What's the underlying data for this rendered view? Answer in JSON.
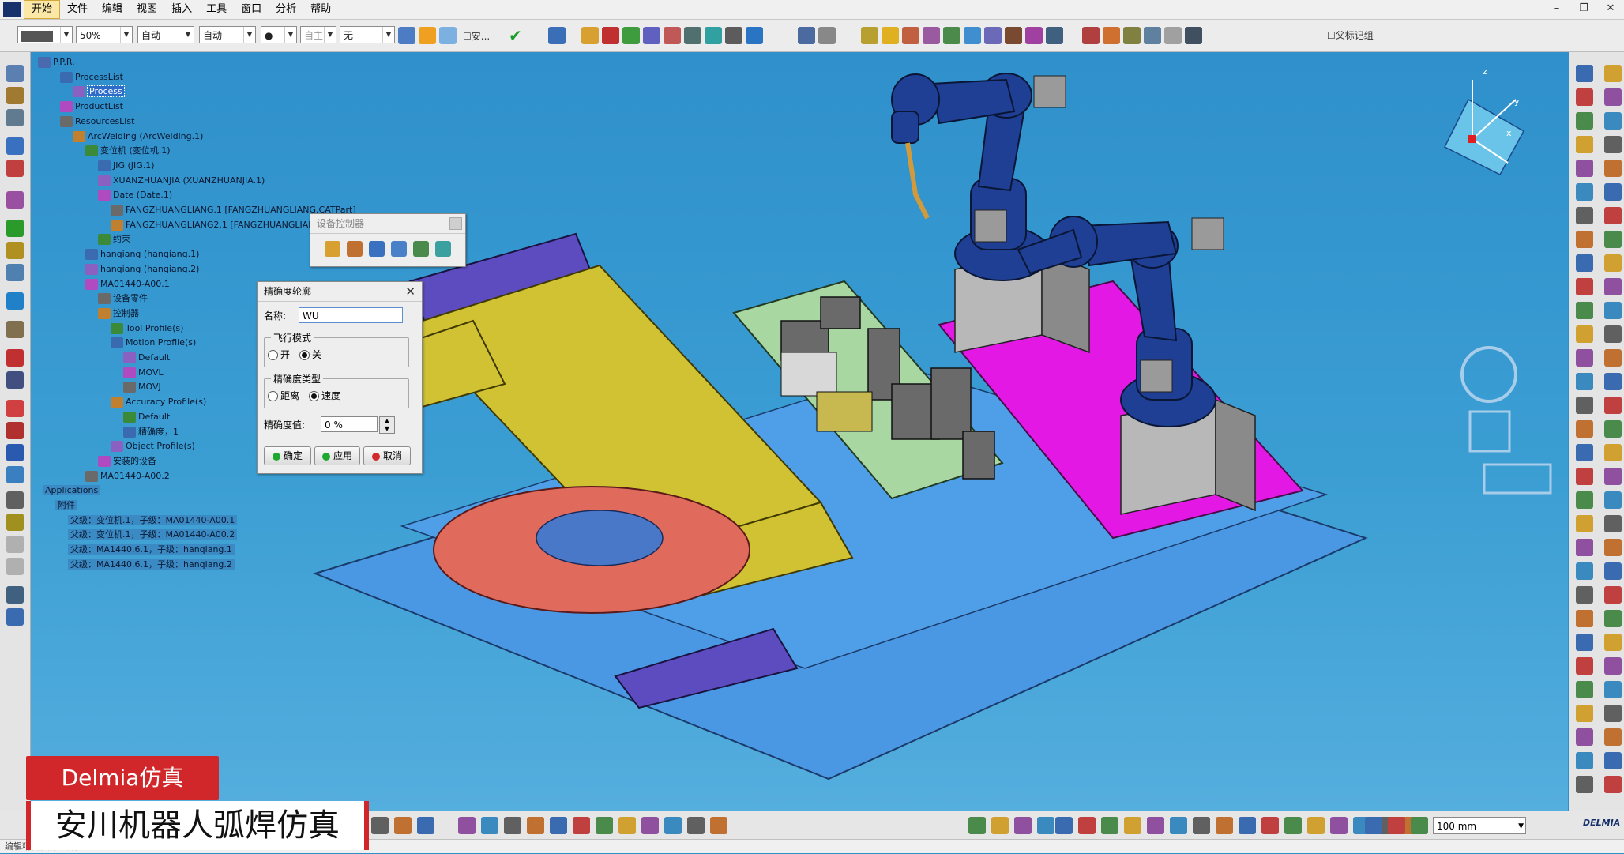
{
  "menu": [
    "开始",
    "文件",
    "编辑",
    "视图",
    "插入",
    "工具",
    "窗口",
    "分析",
    "帮助"
  ],
  "toolbar": {
    "color_value": "",
    "zoom_value": "50%",
    "line_type": "自动",
    "line_weight": "自动",
    "point_style": "●",
    "layer_label": "自主",
    "layer_value": "无",
    "safe_label": "安...",
    "parent_child_label": "父标记组"
  },
  "tree": {
    "root": "P.P.R.",
    "nodes": [
      {
        "label": "ProcessList",
        "indent": 1
      },
      {
        "label": "Process",
        "indent": 2,
        "selected": true
      },
      {
        "label": "ProductList",
        "indent": 1
      },
      {
        "label": "ResourcesList",
        "indent": 1
      },
      {
        "label": "ArcWelding (ArcWelding.1)",
        "indent": 2
      },
      {
        "label": "变位机 (变位机.1)",
        "indent": 3
      },
      {
        "label": "JIG (JIG.1)",
        "indent": 4
      },
      {
        "label": "XUANZHUANJIA (XUANZHUANJIA.1)",
        "indent": 4
      },
      {
        "label": "Date (Date.1)",
        "indent": 4
      },
      {
        "label": "FANGZHUANGLIANG.1 [FANGZHUANGLIANG.CATPart]",
        "indent": 5
      },
      {
        "label": "FANGZHUANGLIANG2.1 [FANGZHUANGLIANG2.CATPart]",
        "indent": 5
      },
      {
        "label": "约束",
        "indent": 4
      },
      {
        "label": "hanqiang (hanqiang.1)",
        "indent": 3
      },
      {
        "label": "hanqiang (hanqiang.2)",
        "indent": 3
      },
      {
        "label": "MA01440-A00.1",
        "indent": 3
      },
      {
        "label": "设备零件",
        "indent": 4
      },
      {
        "label": "控制器",
        "indent": 4
      },
      {
        "label": "Tool Profile(s)",
        "indent": 5
      },
      {
        "label": "Motion Profile(s)",
        "indent": 5
      },
      {
        "label": "Default",
        "indent": 6
      },
      {
        "label": "MOVL",
        "indent": 6
      },
      {
        "label": "MOVJ",
        "indent": 6
      },
      {
        "label": "Accuracy Profile(s)",
        "indent": 5
      },
      {
        "label": "Default",
        "indent": 6
      },
      {
        "label": "精确度，1",
        "indent": 6
      },
      {
        "label": "Object Profile(s)",
        "indent": 5
      },
      {
        "label": "安装的设备",
        "indent": 4
      },
      {
        "label": "MA01440-A00.2",
        "indent": 3
      },
      {
        "label": "Applications",
        "indent": 0,
        "app": true
      },
      {
        "label": "附件",
        "indent": 1,
        "app": true
      },
      {
        "label": "父级：变位机.1，子级：MA01440-A00.1",
        "indent": 2,
        "app": true
      },
      {
        "label": "父级：变位机.1，子级：MA01440-A00.2",
        "indent": 2,
        "app": true
      },
      {
        "label": "父级：MA1440.6.1，子级：hanqiang.1",
        "indent": 2,
        "app": true
      },
      {
        "label": "父级：MA1440.6.1，子级：hanqiang.2",
        "indent": 2,
        "app": true
      }
    ]
  },
  "device_controller": {
    "title": "设备控制器"
  },
  "accuracy_dialog": {
    "title": "精确度轮廓",
    "name_label": "名称:",
    "name_value": "WU",
    "fly_mode_label": "飞行模式",
    "fly_on": "开",
    "fly_off": "关",
    "accuracy_type_label": "精确度类型",
    "type_distance": "距离",
    "type_speed": "速度",
    "accuracy_value_label": "精确度值:",
    "accuracy_value": "0 %",
    "ok": "确定",
    "apply": "应用",
    "cancel": "取消"
  },
  "axes": {
    "x": "x",
    "y": "y",
    "z": "z"
  },
  "bottom": {
    "units_value": "100 mm",
    "brand": "DELMIA"
  },
  "status_text": "编辑精度轮廓的属性",
  "banner": {
    "line1": "Delmia仿真",
    "line2": "安川机器人弧焊仿真"
  },
  "colors": {
    "accent_red": "#d1272b",
    "robot_blue": "#1e3f93",
    "fixture_yellow": "#d1c234",
    "base_magenta": "#e418e4"
  }
}
